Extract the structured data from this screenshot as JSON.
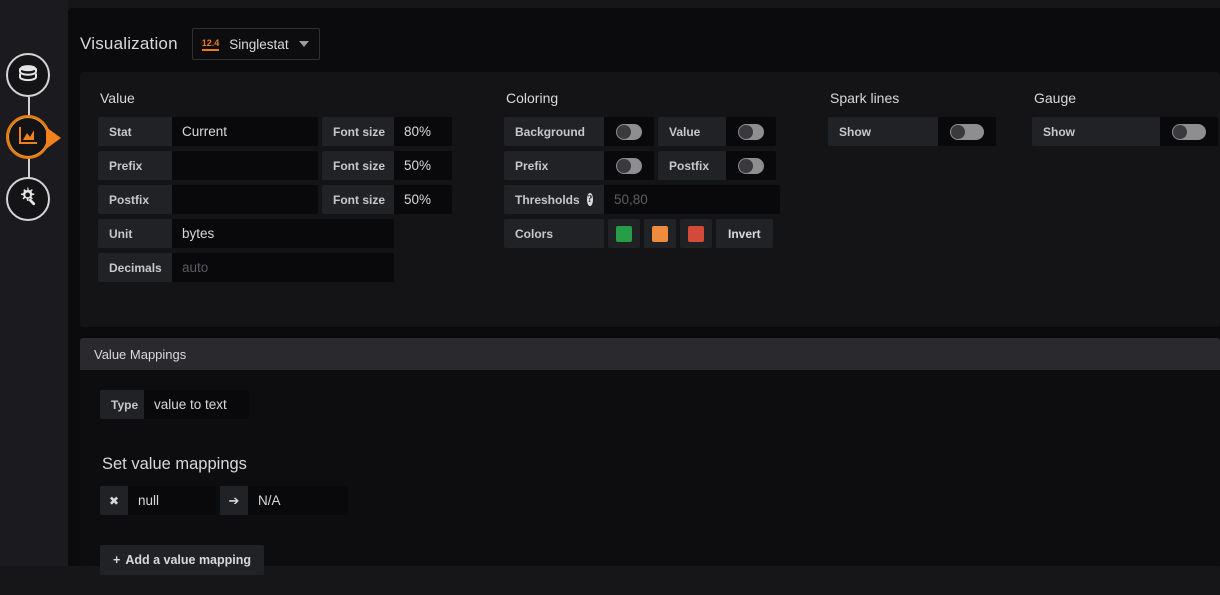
{
  "rail": {
    "items": [
      {
        "name": "datasource",
        "icon": "database-icon",
        "active": false
      },
      {
        "name": "visualization",
        "icon": "graph-icon",
        "active": true
      },
      {
        "name": "general-settings",
        "icon": "gear-wrench-icon",
        "active": false
      }
    ]
  },
  "header": {
    "title": "Visualization",
    "picker": {
      "icon_label": "12.4",
      "value": "Singlestat"
    }
  },
  "value_section": {
    "title": "Value",
    "stat": {
      "label": "Stat",
      "value": "Current"
    },
    "stat_font": {
      "label": "Font size",
      "value": "80%"
    },
    "prefix": {
      "label": "Prefix",
      "value": ""
    },
    "prefix_font": {
      "label": "Font size",
      "value": "50%"
    },
    "postfix": {
      "label": "Postfix",
      "value": ""
    },
    "postfix_font": {
      "label": "Font size",
      "value": "50%"
    },
    "unit": {
      "label": "Unit",
      "value": "bytes"
    },
    "decimals": {
      "label": "Decimals",
      "placeholder": "auto",
      "value": ""
    }
  },
  "coloring_section": {
    "title": "Coloring",
    "background": {
      "label": "Background",
      "state": "off"
    },
    "value": {
      "label": "Value",
      "state": "off"
    },
    "prefix": {
      "label": "Prefix",
      "state": "off"
    },
    "postfix": {
      "label": "Postfix",
      "state": "off"
    },
    "thresholds": {
      "label": "Thresholds",
      "help": "?",
      "placeholder": "50,80",
      "value": ""
    },
    "colors": {
      "label": "Colors",
      "swatches": [
        "#299c46",
        "#ed8c3c",
        "#d44a3a"
      ],
      "invert_label": "Invert"
    }
  },
  "spark_section": {
    "title": "Spark lines",
    "show": {
      "label": "Show",
      "state": "off"
    }
  },
  "gauge_section": {
    "title": "Gauge",
    "show": {
      "label": "Show",
      "state": "off"
    }
  },
  "value_mappings": {
    "header": "Value Mappings",
    "type": {
      "label": "Type",
      "value": "value to text"
    },
    "set_title": "Set value mappings",
    "rows": [
      {
        "remove": "✖",
        "from": "null",
        "arrow": "➔",
        "to": "N/A"
      }
    ],
    "add_button": {
      "plus": "+",
      "label": "Add a value mapping"
    }
  }
}
